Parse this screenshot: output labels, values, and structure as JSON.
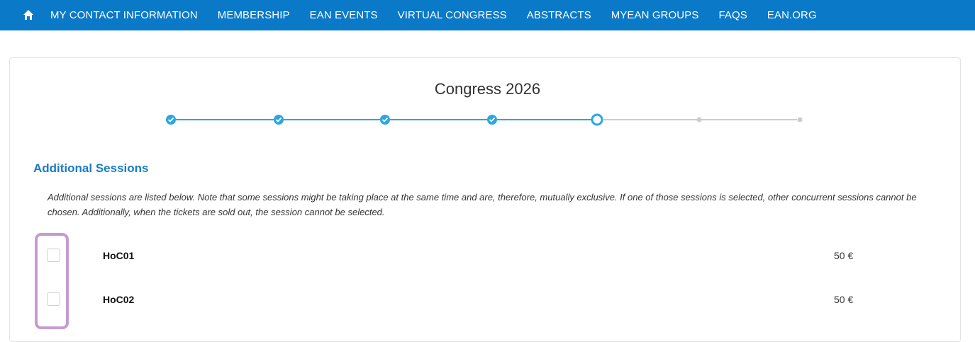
{
  "nav": {
    "home_icon": "home-icon",
    "items": [
      {
        "label": "MY CONTACT INFORMATION"
      },
      {
        "label": "MEMBERSHIP"
      },
      {
        "label": "EAN EVENTS"
      },
      {
        "label": "VIRTUAL CONGRESS"
      },
      {
        "label": "ABSTRACTS"
      },
      {
        "label": "MYEAN GROUPS"
      },
      {
        "label": "FAQS"
      },
      {
        "label": "EAN.ORG"
      }
    ]
  },
  "page": {
    "title": "Congress 2026"
  },
  "stepper": {
    "total_steps": 7,
    "completed_steps": 4,
    "current_step": 5,
    "colors": {
      "active": "#2aa7e2",
      "inactive": "#cccccc"
    }
  },
  "section": {
    "title": "Additional Sessions",
    "description": "Additional sessions are listed below. Note that some sessions might be taking place at the same time and are, therefore, mutually exclusive. If one of those sessions is selected, other concurrent sessions cannot be chosen. Additionally, when the tickets are sold out, the session cannot be selected."
  },
  "sessions": [
    {
      "name": "HoC01",
      "price": "50  €",
      "checked": false
    },
    {
      "name": "HoC02",
      "price": "50  €",
      "checked": false
    }
  ],
  "colors": {
    "nav_bg": "#0a79c8",
    "accent": "#1a7cc4",
    "highlight": "#c69bd1"
  }
}
